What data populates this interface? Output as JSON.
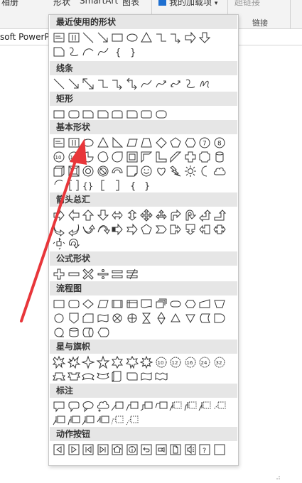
{
  "ribbon": {
    "groups": [
      {
        "label": "相册"
      },
      {
        "label": "形状"
      },
      {
        "label": "SmartArt"
      },
      {
        "label": "图表"
      },
      {
        "label": "我的加载项"
      },
      {
        "label": "超链接"
      },
      {
        "label": "链接"
      }
    ],
    "document_tab": "soft PowerP"
  },
  "gallery": {
    "sections": [
      {
        "title": "最近使用的形状",
        "rows": [
          [
            "textbox",
            "vtextbox",
            "line",
            "line-arrow",
            "rectangle",
            "oval",
            "triangle",
            "elbow",
            "elbow-arrow",
            "right-arrow",
            "down-arrow"
          ],
          [
            "snip",
            "freeform",
            "arc-curve",
            "curve",
            "left-brace",
            "right-brace"
          ]
        ]
      },
      {
        "title": "线条",
        "rows": [
          [
            "line",
            "line-arrow",
            "line-double",
            "elbow",
            "elbow-arrow",
            "elbow-double",
            "curve",
            "curve-arrow",
            "curve-double",
            "freeform",
            "scribble"
          ]
        ]
      },
      {
        "title": "矩形",
        "rows": [
          [
            "rectangle",
            "round-rect",
            "snip-rect",
            "snip-rect",
            "round-top",
            "round-corner",
            "round-rect2",
            "round-rect3"
          ]
        ]
      },
      {
        "title": "基本形状",
        "rows": [
          [
            "textbox",
            "vtextbox",
            "oval",
            "triangle",
            "right-triangle",
            "parallelogram",
            "trapezoid",
            "diamond",
            "pentagon",
            "hexagon",
            "heptagon",
            "octagon"
          ],
          [
            "decagon",
            "dodecagon",
            "pie",
            "chord",
            "teardrop",
            "frame",
            "half-frame",
            "l-shape",
            "diag-stripe",
            "cross",
            "plaque",
            "can"
          ],
          [
            "cube",
            "bevel",
            "donut",
            "no-symbol",
            "block-arc",
            "folded",
            "smiley",
            "heart",
            "lightning",
            "sun",
            "moon",
            "cloud"
          ],
          [
            "arc",
            "bracket-pair",
            "brace-pair",
            "left-bracket",
            "right-bracket",
            "left-brace",
            "right-brace"
          ]
        ]
      },
      {
        "title": "箭头总汇",
        "rows": [
          [
            "right-arrow",
            "left-arrow",
            "up-arrow",
            "down-arrow",
            "lr-arrow",
            "ud-arrow",
            "quad-arrow",
            "lru-arrow",
            "bent-arrow",
            "u-turn",
            "left-up",
            "bent-up"
          ],
          [
            "curved-right",
            "curved-left",
            "curved-up",
            "curved-down",
            "striped",
            "notched",
            "pentagon",
            "chevron",
            "right-callout",
            "down-callout",
            "left-callout",
            "lr-callout"
          ],
          [
            "quad-callout",
            "circular"
          ]
        ]
      },
      {
        "title": "公式形状",
        "rows": [
          [
            "plus",
            "minus",
            "multiply",
            "divide",
            "equal",
            "not-equal"
          ]
        ]
      },
      {
        "title": "流程图",
        "rows": [
          [
            "process",
            "alt-process",
            "decision",
            "data",
            "predefined",
            "internal",
            "document",
            "multidoc",
            "terminator",
            "preparation",
            "manual-input",
            "manual-op"
          ],
          [
            "connector",
            "offpage",
            "card",
            "punched-tape",
            "summing",
            "or",
            "collate",
            "sort",
            "extract",
            "merge",
            "stored-data",
            "delay"
          ],
          [
            "seq-access",
            "magnetic-disk",
            "direct-access",
            "display"
          ]
        ]
      },
      {
        "title": "星与旗帜",
        "rows": [
          [
            "explosion1",
            "explosion2",
            "star4",
            "star5",
            "star6",
            "star7",
            "star8",
            "star10",
            "star12",
            "star16",
            "star24",
            "star32"
          ],
          [
            "ribbon-up",
            "ribbon-down",
            "curved-ribbon-up",
            "curved-ribbon-down",
            "scroll-v",
            "scroll-h",
            "wave",
            "double-wave"
          ]
        ]
      },
      {
        "title": "标注",
        "rows": [
          [
            "rect-callout",
            "round-callout",
            "oval-callout",
            "cloud-callout",
            "line-callout1",
            "line-callout2",
            "line-callout3",
            "line-callout4",
            "accent-callout1",
            "accent-callout2",
            "accent-callout3",
            "accent-callout4"
          ],
          [
            "border-callout1",
            "border-callout2",
            "border-callout3",
            "border-callout4",
            "callout-combo1",
            "callout-combo2"
          ]
        ]
      },
      {
        "title": "动作按钮",
        "rows": [
          [
            "back",
            "forward",
            "beginning",
            "end",
            "home",
            "information",
            "return",
            "movie",
            "document-btn",
            "sound",
            "help",
            "blank"
          ]
        ]
      }
    ]
  },
  "colors": {
    "ribbon_bg": "#f3f3f3",
    "header_bg": "#e6e6e6",
    "arrow": "#e8363a",
    "stroke": "#333333"
  }
}
